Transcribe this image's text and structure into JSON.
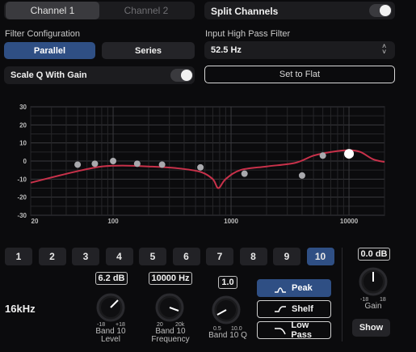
{
  "channel_tabs": [
    "Channel 1",
    "Channel 2"
  ],
  "split": {
    "label": "Split Channels",
    "on": false
  },
  "filter_config": {
    "label": "Filter Configuration",
    "options": [
      "Parallel",
      "Series"
    ],
    "selected": "Parallel"
  },
  "high_pass": {
    "label": "Input High Pass Filter",
    "value": "52.5 Hz"
  },
  "scale_q": {
    "label": "Scale Q With Gain",
    "on": false
  },
  "set_flat_label": "Set to Flat",
  "eq": {
    "y_ticks": [
      "30",
      "20",
      "10",
      "0",
      "-10",
      "-20",
      "-30"
    ],
    "x_ticks": [
      "20",
      "100",
      "1000",
      "10000"
    ],
    "band_points": [
      {
        "band": 1,
        "freq": 50,
        "gain": -2
      },
      {
        "band": 2,
        "freq": 70,
        "gain": -1.5
      },
      {
        "band": 3,
        "freq": 100,
        "gain": 0
      },
      {
        "band": 4,
        "freq": 160,
        "gain": -1.5
      },
      {
        "band": 5,
        "freq": 260,
        "gain": -2
      },
      {
        "band": 6,
        "freq": 550,
        "gain": -3.5
      },
      {
        "band": 7,
        "freq": 1300,
        "gain": -7
      },
      {
        "band": 8,
        "freq": 4000,
        "gain": -8
      },
      {
        "band": 9,
        "freq": 6000,
        "gain": 3
      },
      {
        "band": 10,
        "freq": 10000,
        "gain": 4,
        "active": true
      }
    ],
    "curve_color": "#c8314a"
  },
  "bands": [
    "1",
    "2",
    "3",
    "4",
    "5",
    "6",
    "7",
    "8",
    "9",
    "10"
  ],
  "active_band": "10",
  "freq_display": "16kHz",
  "level": {
    "value": "6.2 dB",
    "min": "-18",
    "max": "+18",
    "label": "Band 10 Level",
    "level": 0.67
  },
  "frequency": {
    "value": "10000 Hz",
    "min": "20",
    "max": "20k",
    "label": "Band 10 Frequency",
    "level": 0.86
  },
  "q": {
    "value": "1.0",
    "min": "0.5",
    "max": "10.0",
    "label": "Band 10 Q",
    "level": 0.1
  },
  "filter_types": [
    {
      "label": "Peak",
      "icon": "peak-filter-icon",
      "selected": true
    },
    {
      "label": "Shelf",
      "icon": "shelf-filter-icon",
      "selected": false
    },
    {
      "label": "Low Pass",
      "icon": "low-pass-filter-icon",
      "selected": false
    }
  ],
  "gain": {
    "value": "0.0 dB",
    "min": "-18",
    "max": "18",
    "label": "Gain",
    "level": 0.5
  },
  "show_label": "Show",
  "colors": {
    "accent": "#2f4f84",
    "curve": "#c8314a",
    "knob_arc": "#4f7ed9"
  }
}
